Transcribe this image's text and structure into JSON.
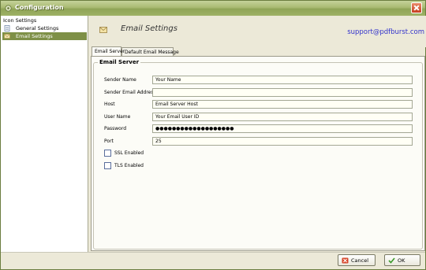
{
  "window": {
    "title": "Configuration"
  },
  "sidebar": {
    "heading": "Icon Settings",
    "items": [
      {
        "label": "General Settings",
        "selected": false,
        "icon": "document-icon"
      },
      {
        "label": "Email Settings",
        "selected": true,
        "icon": "envelope-icon"
      }
    ]
  },
  "header": {
    "title": "Email Settings",
    "support_email": "support@pdfburst.com",
    "icon": "envelope-icon"
  },
  "tabs": [
    {
      "label": "Email Server",
      "active": true
    },
    {
      "label": "Default Email Message",
      "active": false
    }
  ],
  "email_server": {
    "group_title": "Email Server",
    "fields": {
      "sender_name": {
        "label": "Sender Name",
        "value": "Your Name"
      },
      "sender_email": {
        "label": "Sender Email Address",
        "value": ""
      },
      "host": {
        "label": "Host",
        "value": "Email Server Host"
      },
      "user_name": {
        "label": "User Name",
        "value": "Your Email User ID"
      },
      "password": {
        "label": "Password",
        "value": "●●●●●●●●●●●●●●●●●●●"
      },
      "port": {
        "label": "Port",
        "value": "25"
      }
    },
    "ssl": {
      "label": "SSL Enabled",
      "checked": false
    },
    "tls": {
      "label": "TLS Enabled",
      "checked": false
    }
  },
  "buttons": {
    "cancel_label": "Cancel",
    "ok_label": "OK"
  },
  "colors": {
    "titlebar": "#9fb266",
    "selected_item": "#7e9047",
    "link": "#3333cc",
    "close": "#c63d1f"
  }
}
